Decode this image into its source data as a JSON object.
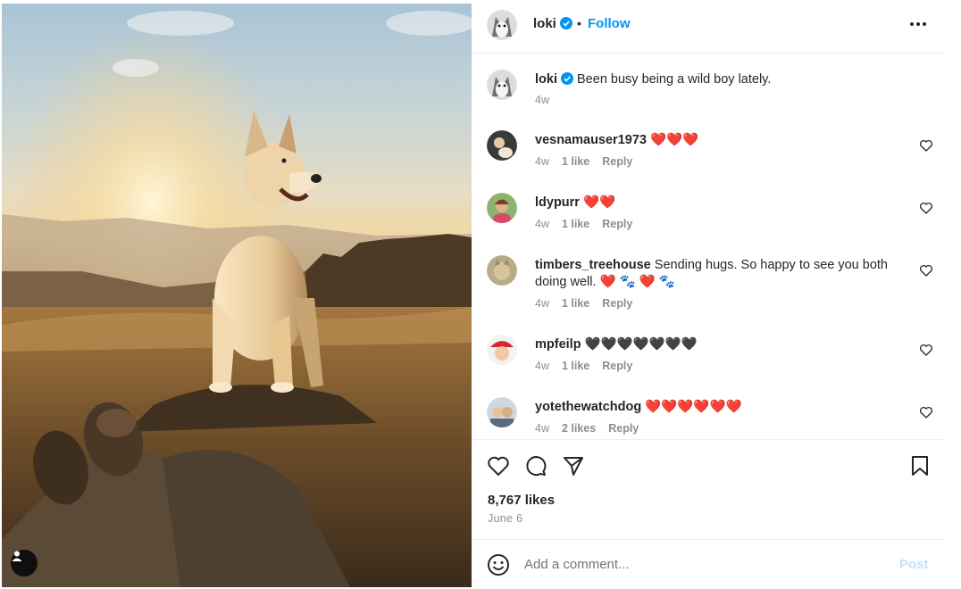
{
  "post": {
    "author": "loki",
    "follow_label": "Follow",
    "separator": "•",
    "caption": {
      "username": "loki",
      "text": "Been busy being a wild boy lately.",
      "time": "4w"
    },
    "comments": [
      {
        "username": "vesnamauser1973",
        "text": "❤️❤️❤️",
        "time": "4w",
        "likes": "1 like",
        "reply": "Reply"
      },
      {
        "username": "ldypurr",
        "text": "❤️❤️",
        "time": "4w",
        "likes": "1 like",
        "reply": "Reply"
      },
      {
        "username": "timbers_treehouse",
        "text": "Sending hugs. So happy to see you both doing well. ❤️ 🐾 ❤️ 🐾",
        "time": "4w",
        "likes": "1 like",
        "reply": "Reply"
      },
      {
        "username": "mpfeilp",
        "text": "🖤🖤🖤🖤🖤🖤🖤",
        "time": "4w",
        "likes": "1 like",
        "reply": "Reply"
      },
      {
        "username": "yotethewatchdog",
        "text": "❤️❤️❤️❤️❤️❤️",
        "time": "4w",
        "likes": "2 likes",
        "reply": "Reply"
      }
    ],
    "likes_count": "8,767 likes",
    "date": "June 6",
    "add_comment_placeholder": "Add a comment...",
    "post_button": "Post"
  },
  "colors": {
    "link_blue": "#0095f6",
    "post_button_disabled": "#c3e2fb",
    "verified_blue": "#0095f6",
    "secondary_text": "#8e8e8e"
  },
  "icons": [
    "verified-badge-icon",
    "more-options-icon",
    "heart-icon",
    "comment-icon",
    "share-icon",
    "bookmark-icon",
    "emoji-icon",
    "user-tag-icon"
  ]
}
